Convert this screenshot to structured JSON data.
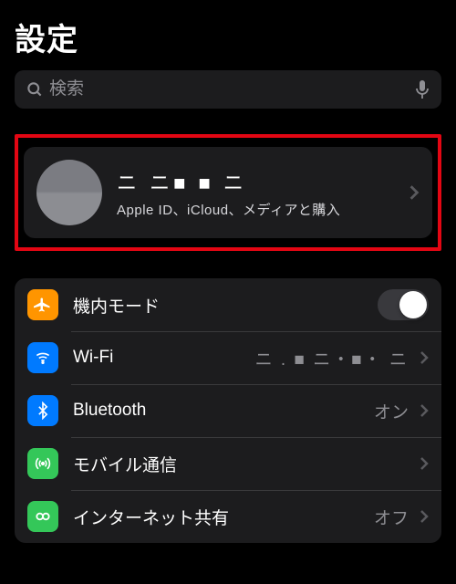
{
  "header": {
    "title": "設定"
  },
  "search": {
    "placeholder": "検索"
  },
  "account": {
    "name": "ニ ニ■ ■ ニ",
    "subtitle": "Apple ID、iCloud、メディアと購入"
  },
  "rows": {
    "airplane": {
      "label": "機内モード"
    },
    "wifi": {
      "label": "Wi-Fi",
      "value": "ニ . ■ ニ・■・ ニ"
    },
    "bluetooth": {
      "label": "Bluetooth",
      "value": "オン"
    },
    "cellular": {
      "label": "モバイル通信"
    },
    "hotspot": {
      "label": "インターネット共有",
      "value": "オフ"
    }
  }
}
